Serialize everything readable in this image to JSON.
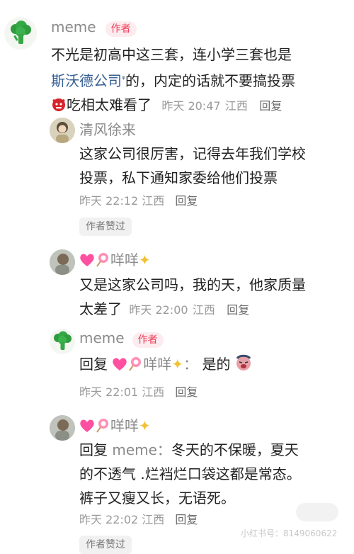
{
  "colors": {
    "author_badge_bg": "#fdecef",
    "author_badge_text": "#ef3b57",
    "link": "#355f93",
    "meta_text": "#9a9a9a"
  },
  "author_badge": "作者",
  "liked_by_author": "作者赞过",
  "comments": [
    {
      "avatar_icon": "broccoli-icon",
      "username": "meme",
      "text_line1": "不光是初高中这三套，连小学三套也是",
      "company_link": "斯沃德公司",
      "text_line2_rest": "的，内定的话就不要搞投票",
      "text_line3": "吃相太难看了",
      "time": "昨天 20:47",
      "location": "江西",
      "reply": "回复"
    },
    {
      "avatar_icon": "user-photo-avatar",
      "username": "清风徐来",
      "text_line1": "这家公司很厉害，记得去年我们学校",
      "text_line2": "投票，私下通知家委给他们投票",
      "time": "昨天 22:12",
      "location": "江西",
      "reply": "回复"
    },
    {
      "avatar_icon": "user-photo-avatar",
      "username": "咩咩",
      "text_line1": "又是这家公司吗，我的天，他家质量",
      "text_line2": "太差了",
      "time": "昨天 22:00",
      "location": "江西",
      "reply": "回复"
    },
    {
      "avatar_icon": "broccoli-icon",
      "username": "meme",
      "reply_prefix": "回复",
      "reply_to": "咩咩",
      "text": "是的",
      "time": "昨天 22:01",
      "location": "江西",
      "reply": "回复"
    },
    {
      "avatar_icon": "user-photo-avatar",
      "username": "咩咩",
      "reply_prefix": "回复",
      "reply_to": "meme：",
      "text_line1": "冬天的不保暖，夏天",
      "text_line2": "的不透气 .烂裆烂口袋这都是常态。",
      "text_line3": "裤子又瘦又长，无语死。",
      "time": "昨天 22:02",
      "location": "江西",
      "reply": "回复"
    }
  ],
  "watermark": "小红书号：8149060622"
}
